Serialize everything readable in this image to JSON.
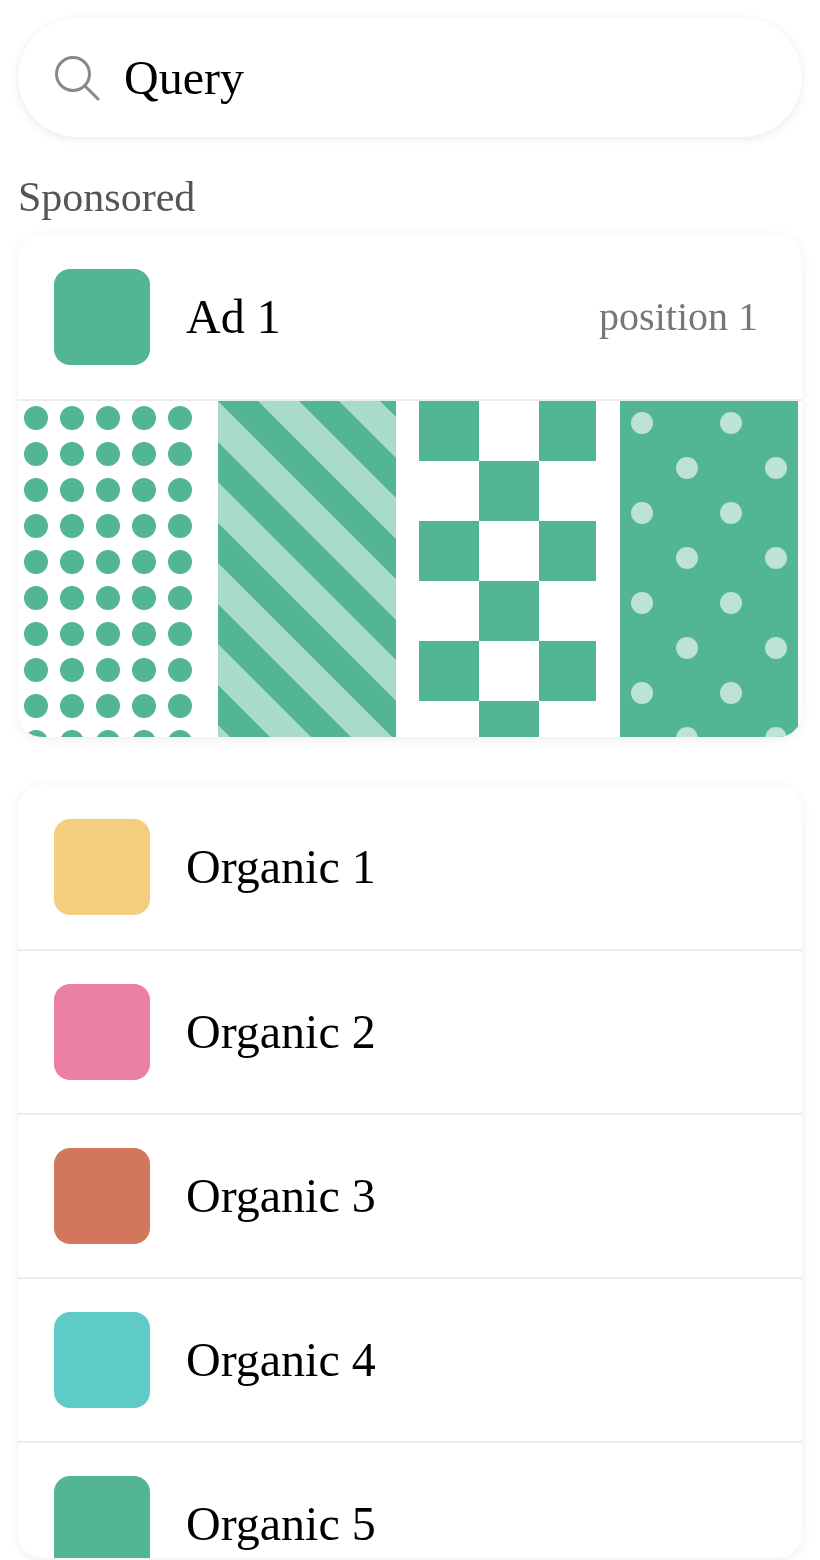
{
  "search": {
    "value": "Query"
  },
  "sponsored": {
    "label": "Sponsored",
    "ad": {
      "title": "Ad 1",
      "position": "position 1",
      "color": "#52b594",
      "tiles": [
        {
          "kind": "dots"
        },
        {
          "kind": "stripes"
        },
        {
          "kind": "checker"
        },
        {
          "kind": "polka"
        }
      ]
    }
  },
  "organic": [
    {
      "title": "Organic 1",
      "color": "#f5cd7e"
    },
    {
      "title": "Organic 2",
      "color": "#ec7fa6"
    },
    {
      "title": "Organic 3",
      "color": "#d2775c"
    },
    {
      "title": "Organic 4",
      "color": "#5ecbc8"
    },
    {
      "title": "Organic 5",
      "color": "#52b594"
    }
  ]
}
